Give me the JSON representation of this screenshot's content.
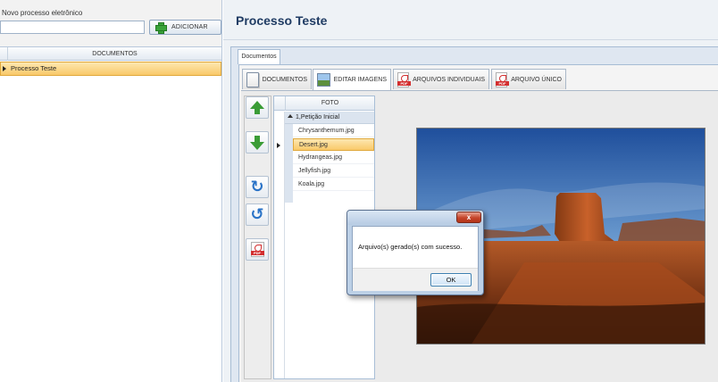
{
  "left": {
    "new_process_label": "Novo processo eletrônico",
    "new_process_value": "",
    "add_button": "ADICIONAR",
    "grid_header": "DOCUMENTOS",
    "rows": [
      "Processo Teste"
    ]
  },
  "main": {
    "title": "Processo Teste",
    "outer_tab": "Documentos",
    "tabs": [
      {
        "label": "DOCUMENTOS",
        "icon": "document-icon"
      },
      {
        "label": "EDITAR IMAGENS",
        "icon": "image-icon",
        "active": true
      },
      {
        "label": "ARQUIVOS INDIVIDUAIS",
        "icon": "pdf-icon"
      },
      {
        "label": "ARQUIVO ÚNICO",
        "icon": "pdf-icon"
      }
    ],
    "toolbar_icons": [
      "arrow-up-icon",
      "arrow-down-icon",
      "rotate-right-icon",
      "rotate-left-icon",
      "pdf-icon"
    ],
    "photo_grid": {
      "header": "FOTO",
      "group": "1,Petição Inicial",
      "files": [
        "Chrysanthemum.jpg",
        "Desert.jpg",
        "Hydrangeas.jpg",
        "Jellyfish.jpg",
        "Koala.jpg"
      ],
      "selected": "Desert.jpg"
    }
  },
  "dialog": {
    "close": "x",
    "message": "Arquivo(s) gerado(s) com sucesso.",
    "ok": "OK"
  },
  "colors": {
    "accent": "#1f3b63",
    "selection": "#f9c96a",
    "close_button": "#c5442a"
  }
}
